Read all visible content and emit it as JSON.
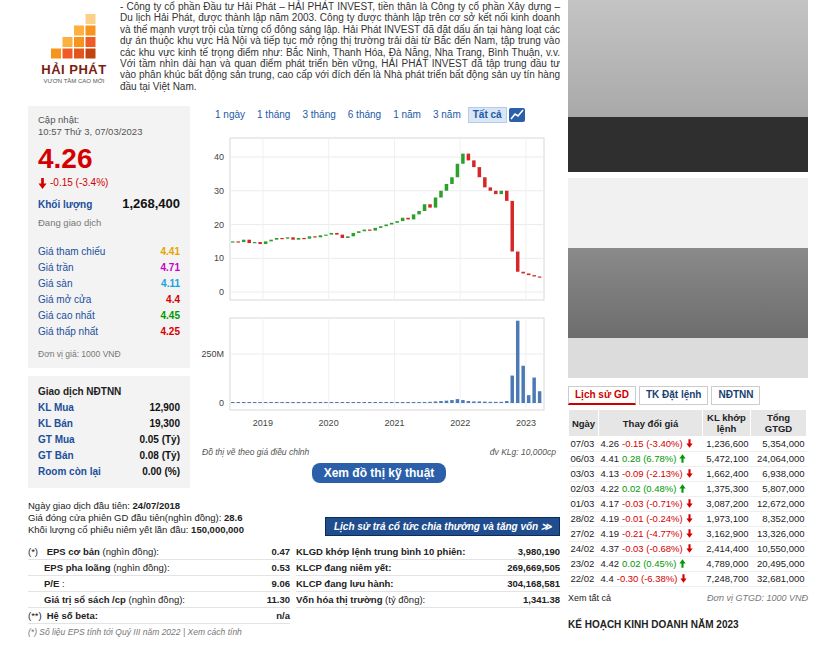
{
  "logo": {
    "name": "HẢI PHÁT",
    "tagline": "VƯƠN TẦM CAO MỚI"
  },
  "description": "- Công ty cổ phần Đầu tư Hải Phát – HẢI PHÁT INVEST, tiền thân là Công ty cổ phần Xây dựng – Du lịch Hải Phát, được thành lập năm 2003. Công ty được thành lập trên cơ sở kết nối kinh doanh và thế mạnh vượt trội của từng cổ đông sáng lập. Hải Phát INVEST đã đặt dấu ấn tại hàng loạt các dự án thuộc khu vực Hà Nội và tiếp tục mở rộng thị trường trải dài từ Bắc đến Nam, tập trung vào các khu vực kinh tế trọng điểm như: Bắc Ninh, Thanh Hóa, Đà Nẵng, Nha Trang, Bình Thuận, v.v. Với tầm nhìn dài hạn và quan điểm phát triển bền vững, HẢI PHÁT INVEST đã tập trung đầu tư vào phân khúc bất động sản trung, cao cấp với đích đến là Nhà phát triển bất động sản uy tín hàng đầu tại Việt Nam.",
  "quote": {
    "updated_label": "Cập nhật:",
    "updated_time": "10:57 Thứ 3, 07/03/2023",
    "price": "4.26",
    "change": "-0.15 (-3.4%)",
    "falling": true,
    "volume_label": "Khối lượng",
    "volume": "1,268,400",
    "status": "Đang giao dịch",
    "prices": [
      {
        "label": "Giá tham chiếu",
        "value": "4.41",
        "color": "#e8a200"
      },
      {
        "label": "Giá trần",
        "value": "4.71",
        "color": "#c800c8"
      },
      {
        "label": "Giá sàn",
        "value": "4.11",
        "color": "#1aa3d9"
      },
      {
        "label": "Giá mở cửa",
        "value": "4.4",
        "color": "#d40000"
      },
      {
        "label": "Giá cao nhất",
        "value": "4.45",
        "color": "#009900"
      },
      {
        "label": "Giá thấp nhất",
        "value": "4.25",
        "color": "#d40000"
      }
    ],
    "price_unit": "Đơn vị giá: 1000 VNĐ"
  },
  "foreign": {
    "title": "Giao dịch NĐTNN",
    "rows": [
      {
        "label": "KL Mua",
        "value": "12,900"
      },
      {
        "label": "KL Bán",
        "value": "19,300"
      },
      {
        "label": "GT Mua",
        "value": "0.05 (Tỷ)"
      },
      {
        "label": "GT Bán",
        "value": "0.08 (Tỷ)"
      },
      {
        "label": "Room còn lại",
        "value": "0.00 (%)"
      }
    ]
  },
  "chart": {
    "periods": [
      {
        "label": "1 ngày",
        "selected": false
      },
      {
        "label": "1 tháng",
        "selected": false
      },
      {
        "label": "3 tháng",
        "selected": false
      },
      {
        "label": "6 tháng",
        "selected": false
      },
      {
        "label": "1 năm",
        "selected": false
      },
      {
        "label": "3 năm",
        "selected": false
      },
      {
        "label": "Tất cả",
        "selected": true
      }
    ],
    "price_ticks": [
      "40",
      "30",
      "20",
      "10",
      "0"
    ],
    "volume_ticks": [
      "250M",
      "0"
    ],
    "x_ticks": [
      "2019",
      "2020",
      "2021",
      "2022",
      "2023"
    ],
    "prices": [
      15,
      14.8,
      15.5,
      14.5,
      14.8,
      14.2,
      15,
      15.5,
      16,
      15.8,
      16.2,
      15.5,
      16,
      15.8,
      16.5,
      16.2,
      16.8,
      17,
      17.5,
      17,
      16,
      16.5,
      17.5,
      18,
      18.5,
      18.2,
      19,
      19.5,
      20,
      20.5,
      21,
      22,
      21.5,
      23,
      24,
      26,
      25,
      28,
      30,
      32,
      34,
      38,
      41,
      39,
      37,
      34,
      31,
      30,
      29,
      30,
      27,
      12,
      6,
      5.5,
      5,
      4.6,
      4.26
    ],
    "volumes": [
      1,
      1,
      1,
      1,
      1,
      1,
      1.5,
      1.5,
      1.5,
      1.5,
      1.5,
      1.5,
      1.5,
      1.5,
      1.5,
      1.5,
      1.5,
      1.5,
      2,
      2,
      2,
      2,
      2,
      2,
      2,
      2,
      2,
      2,
      2,
      2,
      3,
      3,
      4,
      4,
      5,
      5,
      6,
      8,
      10,
      12,
      15,
      20,
      15,
      10,
      8,
      8,
      7,
      6,
      6,
      6,
      10,
      140,
      420,
      190,
      40,
      130,
      60
    ],
    "note": "Đồ thị vẽ theo giá điều chỉnh",
    "unit": "đv KLg: 10,000cp",
    "button": "Xem đồ thị kỹ thuật"
  },
  "listing": [
    {
      "label": "Ngày giao dịch đầu tiên:",
      "value": "24/07/2018"
    },
    {
      "label": "Giá đóng cửa phiên GD đầu tiên(nghìn đồng):",
      "value": "28.6"
    },
    {
      "label": "Khối lượng cổ phiếu niêm yết lần đầu:",
      "value": "150,000,000"
    }
  ],
  "dividend_button": "Lịch sử trả cổ tức chia thưởng và tăng vốn ≫",
  "ratios_left": [
    {
      "prefix": "(*)",
      "label": "EPS cơ bản",
      "unit": "(nghìn đồng):",
      "value": "0.47"
    },
    {
      "label": "EPS pha loãng",
      "unit": "(nghìn đồng):",
      "value": "0.53"
    },
    {
      "label": "P/E",
      "unit": ":",
      "value": "9.06"
    },
    {
      "label": "Giá trị sổ sách /cp",
      "unit": "(nghìn đồng):",
      "value": "11.30"
    },
    {
      "prefix": "(**)",
      "label": "Hệ số beta:",
      "value": "n/a"
    }
  ],
  "ratios_right": [
    {
      "label": "KLGD khớp lệnh trung bình 10 phiên:",
      "value": "3,980,190"
    },
    {
      "label": "KLCP đang niêm yết:",
      "value": "269,669,505"
    },
    {
      "label": "KLCP đang lưu hành:",
      "value": "304,168,581"
    },
    {
      "label": "Vốn hóa thị trường",
      "unit": "(tỷ đồng):",
      "value": "1,341.38"
    }
  ],
  "footnote": {
    "text": "(*) Số liệu EPS tính tới Quý III năm 2022 |",
    "link": "Xem cách tính"
  },
  "right": {
    "tabs": [
      {
        "label": "Lịch sử GD",
        "selected": true
      },
      {
        "label": "TK Đặt lệnh",
        "selected": false
      },
      {
        "label": "NĐTNN",
        "selected": false
      }
    ],
    "columns": [
      "Ngày",
      "Thay đổi giá",
      "KL khớp lệnh",
      "Tổng GTGD"
    ],
    "rows": [
      {
        "date": "07/03",
        "price": "4.26",
        "change": "-0.15 (-3.40%)",
        "kind": "down",
        "volume": "1,236,600",
        "value": "5,354,000"
      },
      {
        "date": "06/03",
        "price": "4.41",
        "change": "0.28 (6.78%)",
        "kind": "up",
        "volume": "5,472,100",
        "value": "24,064,000"
      },
      {
        "date": "03/03",
        "price": "4.13",
        "change": "-0.09 (-2.13%)",
        "kind": "down",
        "volume": "1,662,400",
        "value": "6,938,000"
      },
      {
        "date": "02/03",
        "price": "4.22",
        "change": "0.02 (0.48%)",
        "kind": "up",
        "volume": "1,375,300",
        "value": "5,807,000"
      },
      {
        "date": "01/03",
        "price": "4.17",
        "change": "-0.03 (-0.71%)",
        "kind": "down",
        "volume": "3,087,200",
        "value": "12,672,000"
      },
      {
        "date": "28/02",
        "price": "4.19",
        "change": "-0.01 (-0.24%)",
        "kind": "down",
        "volume": "1,973,100",
        "value": "8,352,000"
      },
      {
        "date": "27/02",
        "price": "4.19",
        "change": "-0.21 (-4.77%)",
        "kind": "down",
        "volume": "3,162,900",
        "value": "13,326,000"
      },
      {
        "date": "24/02",
        "price": "4.37",
        "change": "-0.03 (-0.68%)",
        "kind": "down",
        "volume": "2,414,400",
        "value": "10,550,000"
      },
      {
        "date": "23/02",
        "price": "4.42",
        "change": "0.02 (0.45%)",
        "kind": "up",
        "volume": "4,789,000",
        "value": "20,495,000"
      },
      {
        "date": "22/02",
        "price": "4.4",
        "change": "-0.30 (-6.38%)",
        "kind": "down",
        "volume": "7,248,700",
        "value": "32,681,000"
      }
    ],
    "see_all": "Xem tất cả",
    "unit": "Đơn vị GTGD: 1000 VNĐ",
    "next_title": "KẾ HOẠCH KINH DOANH NĂM 2023"
  }
}
